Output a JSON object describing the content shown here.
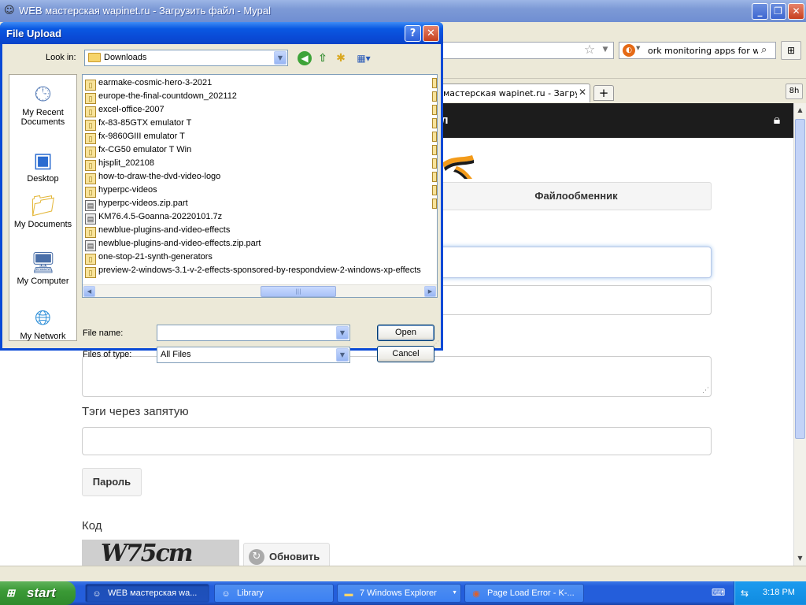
{
  "browser": {
    "title": "WEB мастерская wapinet.ru - Загрузить файл - Mypal",
    "search_text": "ork monitoring apps for win x",
    "tab_active_label": "мастерская wapinet.ru - Загрузит...",
    "side_button_label": "8h"
  },
  "page": {
    "header_fragment": "л",
    "menu_file_exchanger": "Файлообменник",
    "label_tags": "Тэги через запятую",
    "button_password": "Пароль",
    "label_code": "Код",
    "captcha_text": "W75cm",
    "button_refresh": "Обновить"
  },
  "dialog": {
    "title": "File Upload",
    "look_in_label": "Look in:",
    "look_in_value": "Downloads",
    "places": [
      {
        "label": "My Recent Documents",
        "icon": "recent-documents-icon"
      },
      {
        "label": "Desktop",
        "icon": "desktop-icon"
      },
      {
        "label": "My Documents",
        "icon": "my-documents-icon"
      },
      {
        "label": "My Computer",
        "icon": "my-computer-icon"
      },
      {
        "label": "My Network",
        "icon": "my-network-icon"
      }
    ],
    "files": [
      {
        "name": "earmake-cosmic-hero-3-2021",
        "type": "folder"
      },
      {
        "name": "europe-the-final-countdown_202112",
        "type": "folder"
      },
      {
        "name": "excel-office-2007",
        "type": "folder"
      },
      {
        "name": "fx-83-85GTX emulator T",
        "type": "folder"
      },
      {
        "name": "fx-9860GIII emulator T",
        "type": "folder"
      },
      {
        "name": "fx-CG50 emulator T Win",
        "type": "folder"
      },
      {
        "name": "hjsplit_202108",
        "type": "folder"
      },
      {
        "name": "how-to-draw-the-dvd-video-logo",
        "type": "folder"
      },
      {
        "name": "hyperpc-videos",
        "type": "folder"
      },
      {
        "name": "hyperpc-videos.zip.part",
        "type": "file"
      },
      {
        "name": "KM76.4.5-Goanna-20220101.7z",
        "type": "file"
      },
      {
        "name": "newblue-plugins-and-video-effects",
        "type": "folder"
      },
      {
        "name": "newblue-plugins-and-video-effects.zip.part",
        "type": "file"
      },
      {
        "name": "one-stop-21-synth-generators",
        "type": "folder"
      },
      {
        "name": "preview-2-windows-3.1-v-2-effects-sponsored-by-respondview-2-windows-xp-effects",
        "type": "folder"
      }
    ],
    "file_name_label": "File name:",
    "file_name_value": "",
    "files_of_type_label": "Files of type:",
    "files_of_type_value": "All Files",
    "open_button": "Open",
    "cancel_button": "Cancel"
  },
  "taskbar": {
    "start_label": "start",
    "tasks": [
      {
        "label": "WEB мастерская wa..."
      },
      {
        "label": "Library"
      },
      {
        "label": "7 Windows Explorer"
      },
      {
        "label": "Page Load Error - K-..."
      }
    ],
    "clock": "3:18 PM"
  }
}
